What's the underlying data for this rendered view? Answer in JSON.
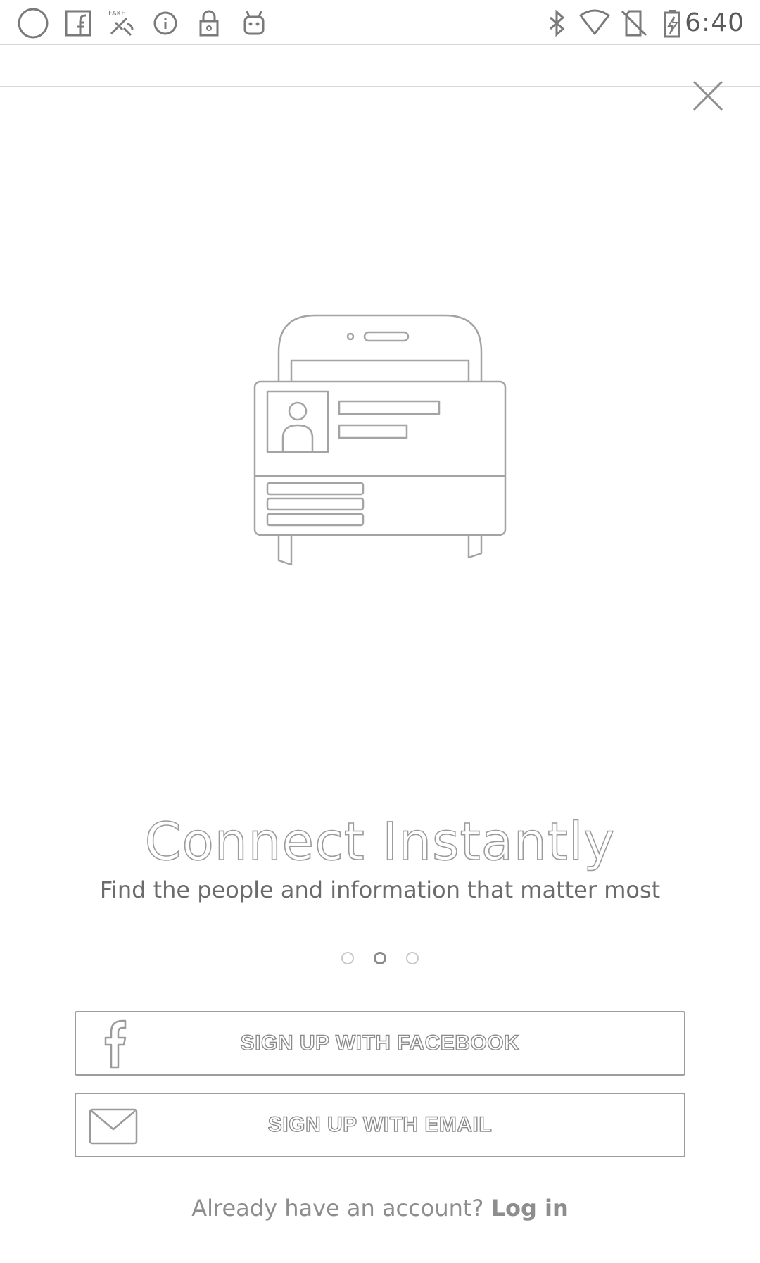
{
  "status_bar": {
    "time": "6:40",
    "left_icons": [
      "circle-icon",
      "facebook-notification-icon",
      "fake-gps-icon",
      "info-icon",
      "lock-icon",
      "android-icon"
    ],
    "right_icons": [
      "bluetooth-icon",
      "wifi-icon",
      "no-sim-icon",
      "battery-charging-icon"
    ]
  },
  "onboarding": {
    "title": "Connect Instantly",
    "subtitle": "Find the people and information that matter most",
    "page_count": 3,
    "active_page": 2
  },
  "actions": {
    "facebook_label": "SIGN UP WITH FACEBOOK",
    "email_label": "SIGN UP WITH EMAIL",
    "login_prompt": "Already have an account?",
    "login_link": "Log in"
  },
  "colors": {
    "outline": "#9e9e9e",
    "text": "#6b6b6b",
    "background": "#ffffff"
  }
}
